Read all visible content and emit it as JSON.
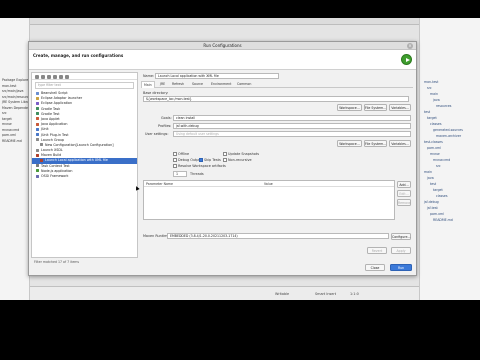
{
  "dialog": {
    "title": "Run Configurations",
    "header": "Create, manage, and run configurations"
  },
  "left_panel": {
    "filter_placeholder": "type filter text",
    "items": [
      {
        "label": "Beanshell Script",
        "indent": 1,
        "color": "#6a8ed0"
      },
      {
        "label": "Eclipse Adaptor launcher",
        "indent": 1,
        "color": "#c8a040"
      },
      {
        "label": "Eclipse Application",
        "indent": 1,
        "color": "#7a5ec8"
      },
      {
        "label": "Gradle Task",
        "indent": 1,
        "color": "#3f8e5e"
      },
      {
        "label": "Gradle Test",
        "indent": 1,
        "color": "#3f8e5e"
      },
      {
        "label": "Java Applet",
        "indent": 1,
        "color": "#c85a3a"
      },
      {
        "label": "Java Application",
        "indent": 1,
        "color": "#c85a3a"
      },
      {
        "label": "JUnit",
        "indent": 1,
        "color": "#4a78c8"
      },
      {
        "label": "JUnit Plug-in Test",
        "indent": 1,
        "color": "#4a78c8"
      },
      {
        "label": "Launch Group",
        "indent": 1,
        "color": "#8a8a8a"
      },
      {
        "label": "New Configuration[Launch Configuration]",
        "indent": 2,
        "color": "#8a8a8a"
      },
      {
        "label": "Launch XSDL",
        "indent": 1,
        "color": "#8a8a8a"
      },
      {
        "label": "Maven Build",
        "indent": 1,
        "color": "#b0402a"
      },
      {
        "label": "Launch Local application with XML file",
        "indent": 2,
        "color": "#b0402a",
        "selected": true
      },
      {
        "label": "Task Context Test",
        "indent": 1,
        "color": "#7a7a7a"
      },
      {
        "label": "Node.js application",
        "indent": 1,
        "color": "#4a9a3a"
      },
      {
        "label": "OSGi Framework",
        "indent": 1,
        "color": "#6a6ab0"
      }
    ],
    "footer": "Filter matched 17 of 7 items"
  },
  "right_panel": {
    "name_label": "Name:",
    "name_value": "Launch Local application with XML file",
    "tabs": [
      "Main",
      "JRE",
      "Refresh",
      "Source",
      "Environment",
      "Common"
    ],
    "base_dir_label": "Base directory:",
    "base_dir_value": "${workspace_loc:/mon-test}",
    "buttons_row1": [
      "Workspace...",
      "File System...",
      "Variables..."
    ],
    "goals_label": "Goals:",
    "goals_value": "clean install",
    "profiles_label": "Profiles:",
    "profiles_value": "jsf-with-debug",
    "user_settings_label": "User settings:",
    "user_settings_placeholder": "Using default user settings",
    "buttons_row2": [
      "Workspace...",
      "File System...",
      "Variables..."
    ],
    "checkboxes": [
      {
        "label": "Offline",
        "checked": false
      },
      {
        "label": "Update Snapshots",
        "checked": false
      },
      {
        "label": "Debug Output",
        "checked": false
      },
      {
        "label": "Skip Tests",
        "checked": true
      },
      {
        "label": "Non-recursive",
        "checked": false
      },
      {
        "label": "Resolve Workspace artifacts",
        "checked": false
      }
    ],
    "threads_value": "1",
    "threads_label": "Threads",
    "params_header": "Parameter Name",
    "params_value_header": "Value",
    "params_buttons": [
      "Add...",
      "Edit...",
      "Remove"
    ],
    "runtime_label": "Maven Runtime:",
    "runtime_value": "EMBEDDED (3.8.4/1.20.0.20211203-1714)",
    "configure_button": "Configure...",
    "revert_button": "Revert",
    "apply_button": "Apply"
  },
  "footer": {
    "close_button": "Close",
    "run_button": "Run"
  },
  "background": {
    "left_rows": [
      "Package Explorer",
      "mon-test",
      "src/main/java",
      "src/main/resources",
      "JRE System Library",
      "Maven Dependencies",
      "src",
      "target",
      "mvnw",
      "mvnw.cmd",
      "pom.xml",
      "README.md"
    ],
    "right_rows": [
      "mon-test",
      "src",
      "main",
      "java",
      "resources",
      "test",
      "target",
      "classes",
      "generated-sources",
      "maven-archiver",
      "test-classes",
      "pom.xml",
      "mvnw",
      "mvnw.cmd",
      "src",
      "main",
      "java",
      "test",
      "target",
      "classes",
      "jsf-debug",
      "jsf-test",
      "pom.xml",
      "README.md"
    ],
    "right_selected": "pom.xml",
    "status_items": [
      "Writable",
      "Smart Insert",
      "1:1:0"
    ]
  },
  "colors": {
    "selection": "#3a6fc8",
    "primary_button": "#3b79d9",
    "run_logo": "#3f9e2e"
  }
}
